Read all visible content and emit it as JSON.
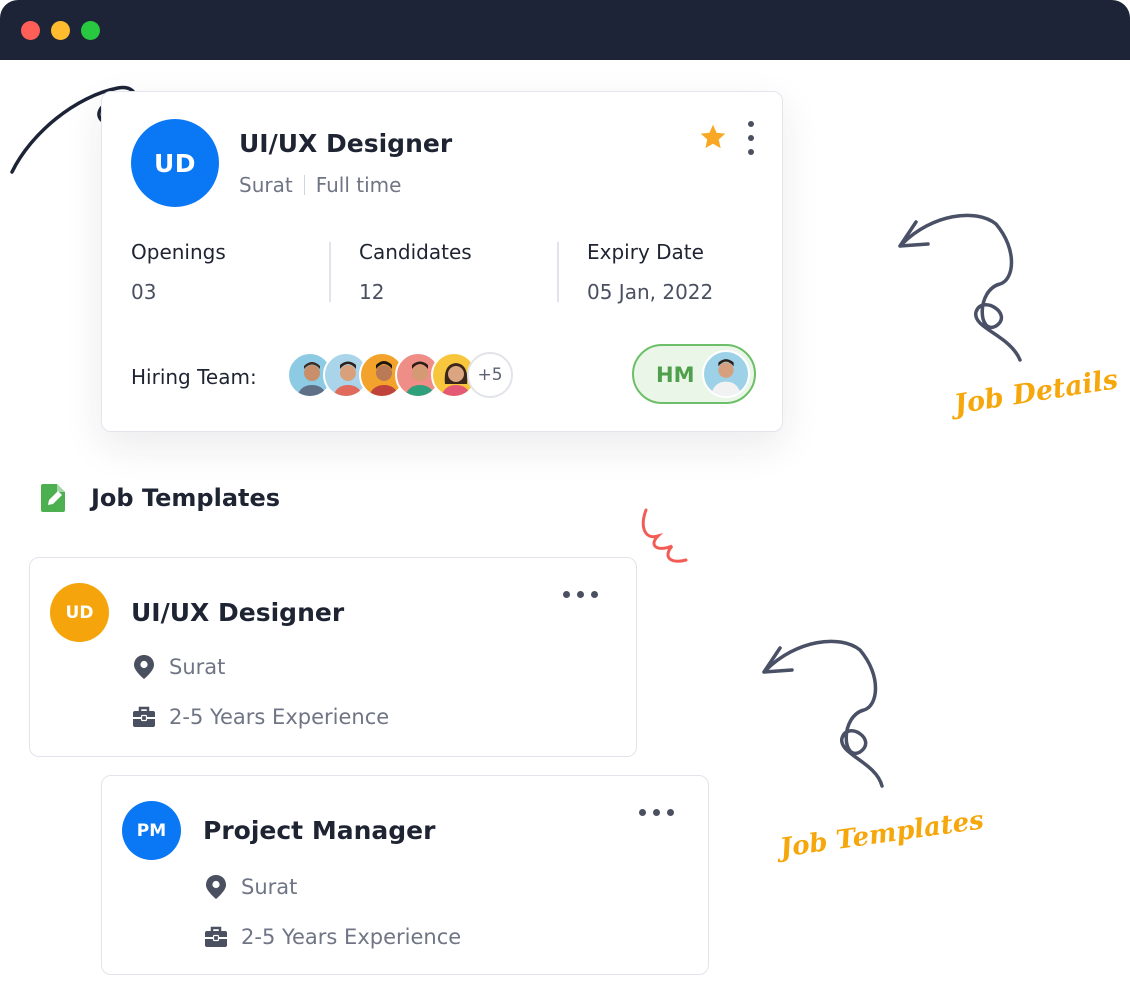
{
  "window": {
    "controls": [
      "close",
      "minimize",
      "maximize"
    ]
  },
  "job_card": {
    "initials": "UD",
    "title": "UI/UX Designer",
    "location": "Surat",
    "employment_type": "Full time",
    "stats": [
      {
        "label": "Openings",
        "value": "03"
      },
      {
        "label": "Candidates",
        "value": "12"
      },
      {
        "label": "Expiry Date",
        "value": "05 Jan, 2022"
      }
    ],
    "hiring_team_label": "Hiring Team:",
    "hiring_team_more": "+5",
    "hiring_manager_initials": "HM",
    "colors": {
      "avatar": "#0a78f5",
      "star": "#f9a825",
      "hm_border": "#6cbf68"
    },
    "icons": [
      "star-icon",
      "more-vertical-icon"
    ]
  },
  "templates_section": {
    "title": "Job Templates",
    "icon": "document-edit-icon",
    "cards": [
      {
        "initials": "UD",
        "title": "UI/UX Designer",
        "location": "Surat",
        "experience": "2-5 Years Experience",
        "color": "#f5a50b"
      },
      {
        "initials": "PM",
        "title": "Project Manager",
        "location": "Surat",
        "experience": "2-5 Years Experience",
        "color": "#0a78f5"
      }
    ]
  },
  "annotations": {
    "job_details": "Job Details",
    "job_templates": "Job Templates"
  }
}
